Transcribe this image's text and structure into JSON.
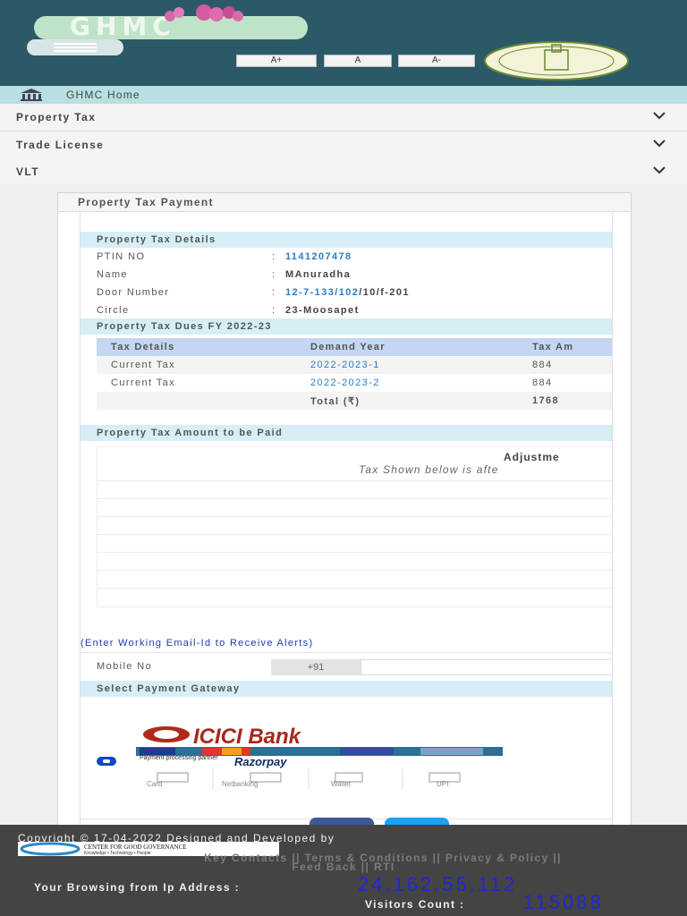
{
  "header": {
    "logo_text": "GHMC",
    "font_buttons": [
      "A+",
      "A",
      "A-"
    ]
  },
  "nav": {
    "home": "GHMC Home",
    "accordion": [
      "Property Tax",
      "Trade License",
      "VLT"
    ]
  },
  "panel": {
    "title": "Property Tax Payment",
    "details_heading": "Property Tax Details",
    "details": {
      "ptin_label": "PTIN NO",
      "ptin_value": "1141207478",
      "name_label": "Name",
      "name_value": "MAnuradha",
      "door_label": "Door Number",
      "door_value_link": "12-7-133/102",
      "door_value_rest": "/10/f-201",
      "circle_label": "Circle",
      "circle_value": "23-Moosapet",
      "colon": ":"
    },
    "dues_heading": "Property Tax Dues FY 2022-23",
    "dues_table": {
      "headers": [
        "Tax Details",
        "Demand Year",
        "Tax Am"
      ],
      "rows": [
        [
          "Current Tax",
          "2022-2023-1",
          "884"
        ],
        [
          "Current Tax",
          "2022-2023-2",
          "884"
        ]
      ],
      "total_label": "Total (₹)",
      "total_value": "1768"
    },
    "amount_heading": "Property Tax Amount to be Paid",
    "adjustment_title": "Adjustme",
    "adjustment_note": "Tax Shown below is afte",
    "email_note": "(Enter Working Email-Id to Receive Alerts)",
    "mobile_label": "Mobile No",
    "mobile_prefix": "+91",
    "mobile_value": "",
    "gateway_heading": "Select Payment Gateway",
    "gateway": {
      "bank_name": "ICICI Bank",
      "partner_text": "Payment processing partner",
      "partner_name": "Razorpay",
      "methods": [
        "Card",
        "Netbanking",
        "Wallet",
        "UPI"
      ]
    }
  },
  "footer": {
    "copyright": "Copyright © 17-04-2022 Designed and Developed by",
    "cgg_name": "CENTER FOR GOOD GOVERNANCE",
    "cgg_tagline": "Knowledge • Technology • People",
    "links_line1": "Key Contacts || Terms & Conditions || Privacy & Policy ||",
    "links_line2": "Feed Back || RTI",
    "ip_label": "Your Browsing from Ip Address :",
    "ip_value": "24.162.55.112",
    "visitors_label": "Visitors Count :",
    "visitors_value": "115088"
  },
  "colors": {
    "header_bg": "#2c5968",
    "section_bg": "#d6eef5",
    "table_header_bg": "#c4d6f1",
    "link": "#2a7dc4",
    "footer_bg": "#444444",
    "counter_blue": "#1f27d6",
    "facebook": "#3b5998",
    "twitter": "#1da1f2"
  }
}
